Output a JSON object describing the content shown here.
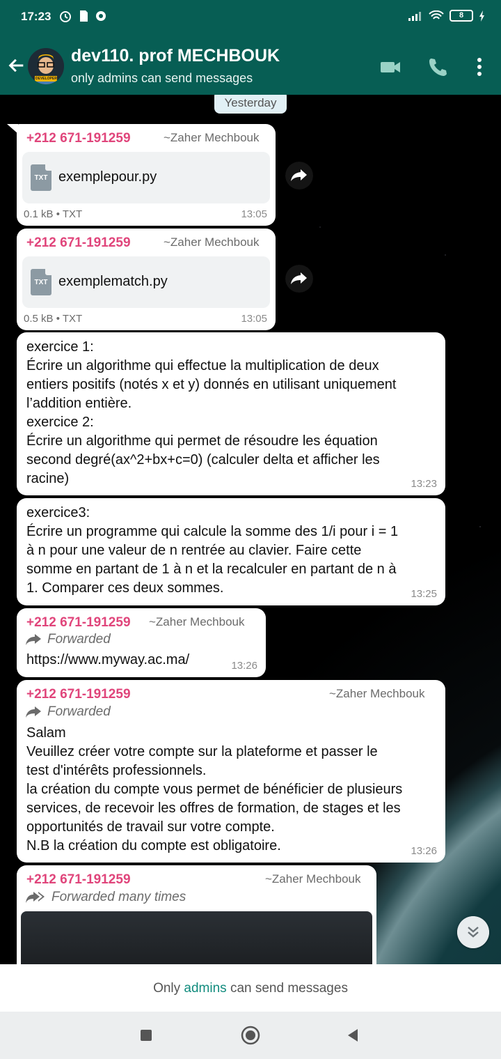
{
  "status_bar": {
    "time": "17:23",
    "battery": "8"
  },
  "header": {
    "title": "dev110. prof MECHBOUK",
    "subtitle": "only admins can send messages",
    "avatar_caption": "DEVELOPER"
  },
  "chat": {
    "date_label": "Yesterday",
    "messages": [
      {
        "sender": "+212 671-191259",
        "author": "~Zaher Mechbouk",
        "file_name": "exemplepour.py",
        "file_type_badge": "TXT",
        "file_meta": "0.1 kB • TXT",
        "time": "13:05"
      },
      {
        "sender": "+212 671-191259",
        "author": "~Zaher Mechbouk",
        "file_name": "exemplematch.py",
        "file_type_badge": "TXT",
        "file_meta": "0.5 kB • TXT",
        "time": "13:05"
      },
      {
        "lines": [
          "exercice 1:",
          "Écrire un algorithme qui effectue la multiplication de deux",
          "entiers positifs (notés x et y) donnés en utilisant uniquement",
          "l’addition entière.",
          "exercice 2:",
          "Écrire un algorithme qui permet de résoudre les équation",
          "second degré(ax^2+bx+c=0)  (calculer delta et afficher les",
          "racine)"
        ],
        "time": "13:23"
      },
      {
        "lines": [
          "exercice3:",
          "Écrire un programme qui calcule la somme des 1/i pour i = 1",
          "à n pour une valeur de n rentrée au clavier. Faire cette",
          "somme en partant de 1 à n et la recalculer en partant de n à",
          "1. Comparer ces deux sommes."
        ],
        "time": "13:25"
      },
      {
        "sender": "+212 671-191259",
        "author": "~Zaher Mechbouk",
        "forwarded": "Forwarded",
        "link": "https://www.myway.ac.ma/",
        "time": "13:26"
      },
      {
        "sender": "+212 671-191259",
        "author": "~Zaher Mechbouk",
        "forwarded": "Forwarded",
        "lines": [
          "Salam",
          "Veuillez créer votre compte sur la plateforme et passer le",
          "test d'intérêts professionnels.",
          "la création du compte vous permet de bénéficier de plusieurs",
          "services, de recevoir les offres de formation, de stages et les",
          "opportunités de travail sur votre compte.",
          "N.B la création du compte est obligatoire."
        ],
        "time": "13:26"
      },
      {
        "sender": "+212 671-191259",
        "author": "~Zaher Mechbouk",
        "forwarded": "Forwarded many times"
      }
    ]
  },
  "footer": {
    "text_before": "Only ",
    "text_link": "admins",
    "text_after": " can send messages"
  },
  "icons": {
    "back": "arrow-left-icon",
    "video": "video-call-icon",
    "call": "phone-icon",
    "menu": "more-vertical-icon",
    "share": "share-forward-icon",
    "scroll": "double-chevron-down-icon"
  },
  "colors": {
    "header": "#075e54",
    "sender": "#e0457b",
    "admins_link": "#128c7e"
  }
}
